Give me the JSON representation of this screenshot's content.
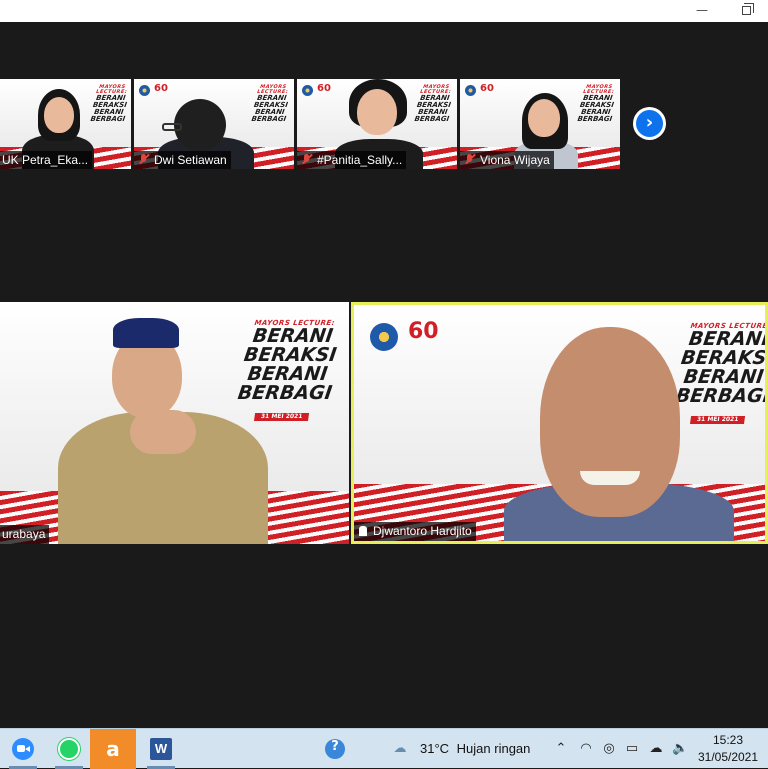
{
  "window": {
    "minimize_glyph": "—",
    "restore_icon": "restore-icon"
  },
  "poster": {
    "kicker": "MAYORS LECTURE:",
    "lines": [
      "BERANI",
      "BERAKSI",
      "BERANI",
      "BERBAGI"
    ],
    "date": "31 MEI 2021",
    "logo_number": "60"
  },
  "gallery": {
    "participants": [
      {
        "name": "UK Petra_Eka...",
        "muted": false
      },
      {
        "name": "Dwi Setiawan",
        "muted": true
      },
      {
        "name": "#Panitia_Sally...",
        "muted": true
      },
      {
        "name": "Viona Wijaya",
        "muted": true
      }
    ],
    "next_page_glyph": "›"
  },
  "speakers": {
    "left": {
      "name": "urabaya",
      "muted": false
    },
    "right": {
      "name": "Djwantoro Hardjito",
      "muted": false,
      "active_speaker": true
    }
  },
  "taskbar": {
    "apps": [
      {
        "name": "zoom-app",
        "color": "#2d8cff"
      },
      {
        "name": "whatsapp-app",
        "color": "#25d366"
      },
      {
        "name": "avast-app",
        "color": "#f28c28"
      },
      {
        "name": "word-app",
        "color": "#2b579a"
      }
    ],
    "weather": {
      "temp": "31°C",
      "desc": "Hujan ringan"
    },
    "clock": {
      "time": "15:23",
      "date": "31/05/2021"
    }
  },
  "colors": {
    "accent_red": "#d11f26",
    "active_speaker_border": "#e6ef5a",
    "zoom_blue": "#0e72ed",
    "taskbar_bg": "#d3e4f0"
  }
}
